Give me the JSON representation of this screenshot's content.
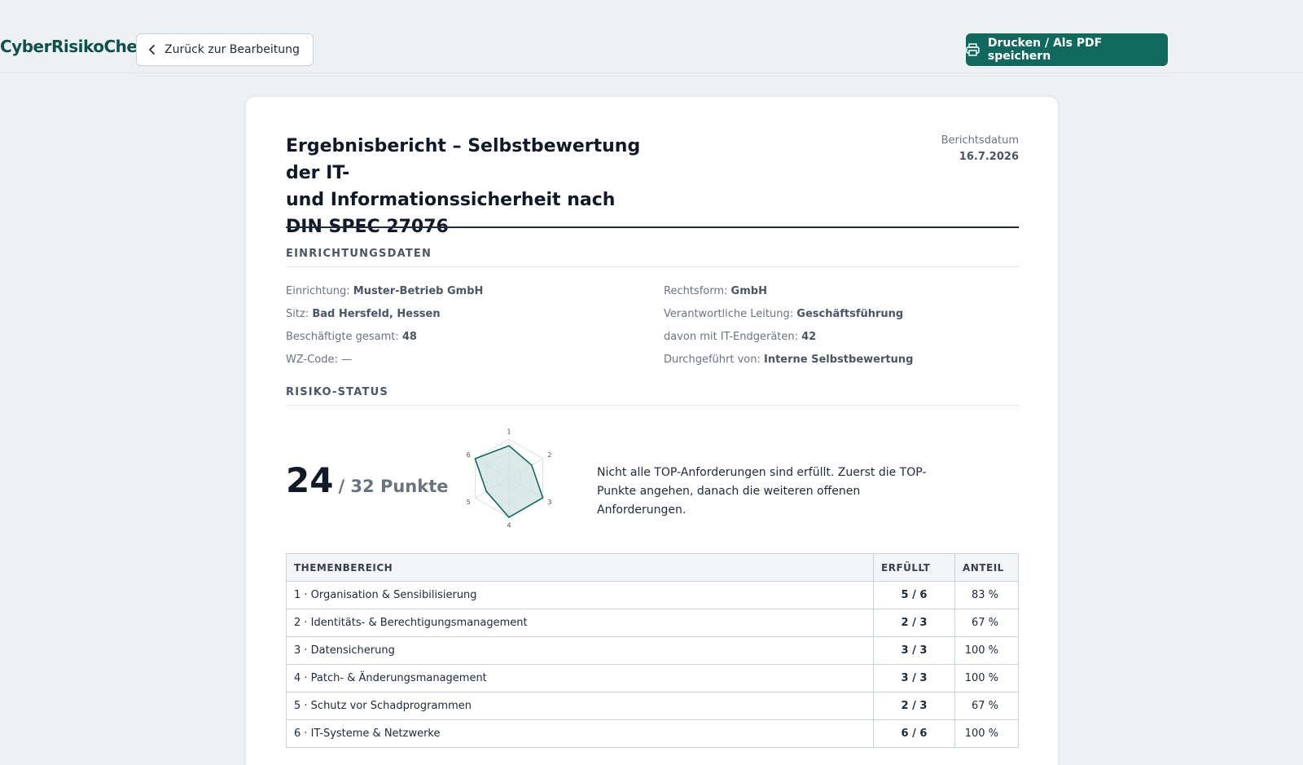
{
  "header": {
    "brand": "CyberRisikoCheck",
    "back_label": "Zurück zur Bearbeitung",
    "print_label": "Drucken / Als PDF speichern"
  },
  "report": {
    "title_line1": "Ergebnisbericht – Selbstbewertung der IT-",
    "title_line2": "und Informationssicherheit nach",
    "title_line3": "DIN SPEC 27076",
    "date_label": "Berichtsdatum",
    "date_value": "16.7.2026"
  },
  "facility": {
    "section_title": "EINRICHTUNGSDATEN",
    "fields": [
      {
        "label": "Einrichtung:",
        "value": "Muster-Betrieb GmbH"
      },
      {
        "label": "Rechtsform:",
        "value": "GmbH"
      },
      {
        "label": "Sitz:",
        "value": "Bad Hersfeld, Hessen"
      },
      {
        "label": "Verantwortliche Leitung:",
        "value": "Geschäftsführung"
      },
      {
        "label": "Beschäftigte gesamt:",
        "value": "48"
      },
      {
        "label": "davon mit IT-Endgeräten:",
        "value": "42"
      },
      {
        "label": "WZ-Code:",
        "value": "—"
      },
      {
        "label": "Durchgeführt von:",
        "value": "Interne Selbstbewertung"
      }
    ]
  },
  "risk": {
    "section_title": "RISIKO-STATUS",
    "score": "24",
    "score_suffix": "/ 32 Punkte",
    "message": "Nicht alle TOP-Anforderungen sind erfüllt. Zuerst die TOP-Punkte angehen, danach die weiteren offenen Anforderungen.",
    "radar_labels": [
      "1",
      "2",
      "3",
      "4",
      "5",
      "6"
    ],
    "radar_values": [
      0.83,
      0.67,
      1.0,
      1.0,
      0.67,
      1.0
    ],
    "radar_fill": "#cfe3df",
    "radar_stroke": "#11695d"
  },
  "table": {
    "headers": [
      "THEMENBEREICH",
      "ERFÜLLT",
      "ANTEIL"
    ],
    "rows": [
      {
        "topic": "1 · Organisation & Sensibilisierung",
        "fulfilled": "5 / 6",
        "share": "83 %"
      },
      {
        "topic": "2 · Identitäts- & Berechtigungsmanagement",
        "fulfilled": "2 / 3",
        "share": "67 %"
      },
      {
        "topic": "3 · Datensicherung",
        "fulfilled": "3 / 3",
        "share": "100 %"
      },
      {
        "topic": "4 · Patch- & Änderungsmanagement",
        "fulfilled": "3 / 3",
        "share": "100 %"
      },
      {
        "topic": "5 · Schutz vor Schadprogrammen",
        "fulfilled": "2 / 3",
        "share": "67 %"
      },
      {
        "topic": "6 · IT-Systeme & Netzwerke",
        "fulfilled": "6 / 6",
        "share": "100 %"
      }
    ]
  },
  "colors": {
    "accent": "#11695d",
    "brand": "#0f5149"
  }
}
